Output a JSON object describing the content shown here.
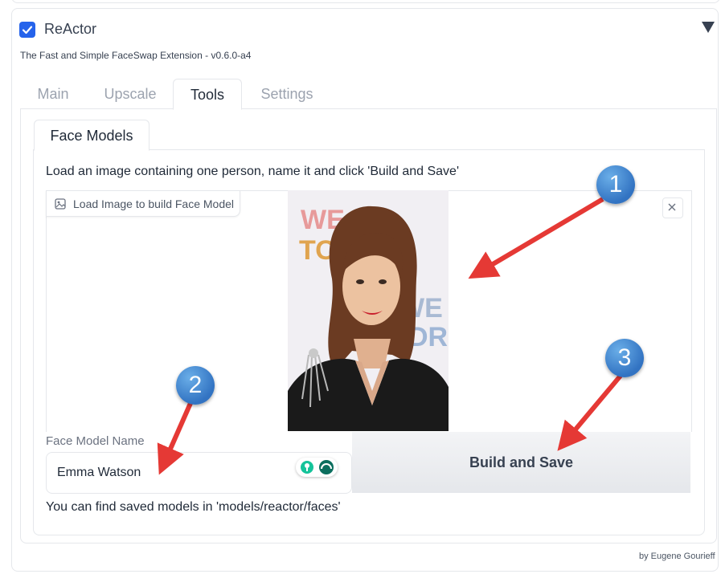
{
  "extension": {
    "enabled": true,
    "title": "ReActor",
    "subtitle": "The Fast and Simple FaceSwap Extension - v0.6.0-a4",
    "author": "by Eugene Gourieff"
  },
  "tabs": [
    {
      "label": "Main",
      "active": false
    },
    {
      "label": "Upscale",
      "active": false
    },
    {
      "label": "Tools",
      "active": true
    },
    {
      "label": "Settings",
      "active": false
    }
  ],
  "tools": {
    "subtab": "Face Models",
    "instructions": "Load an image containing one person, name it and click 'Build and Save'",
    "upload_label": "Load Image to build Face Model",
    "name_field": {
      "label": "Face Model Name",
      "value": "Emma Watson"
    },
    "build_button": "Build and Save",
    "hint": "You can find saved models in 'models/reactor/faces'"
  },
  "photo_backdrop_text": [
    "WE",
    "TO",
    "WE DA",
    "DRE"
  ],
  "callouts": [
    "1",
    "2",
    "3"
  ],
  "colors": {
    "accent": "#2563eb",
    "callout": "#3a7bc8",
    "arrow": "#e53935"
  }
}
